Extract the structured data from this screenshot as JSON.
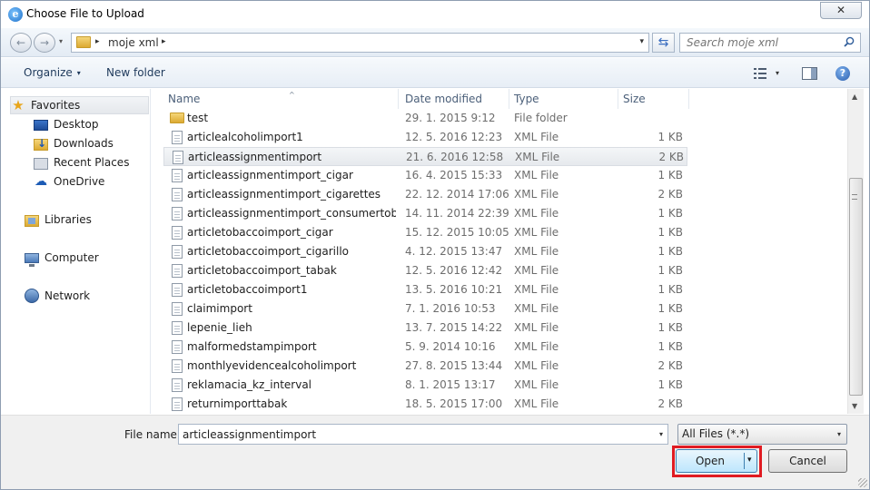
{
  "window": {
    "title": "Choose File to Upload",
    "close_glyph": "✕",
    "title_icon_glyph": "e"
  },
  "nav": {
    "back_glyph": "←",
    "forward_glyph": "→",
    "dropdown_glyph": "▾",
    "path_separator": "▸",
    "path": "moje xml",
    "address_dropdown_glyph": "▾",
    "refresh_glyph": "⇆",
    "search_placeholder": "Search moje xml"
  },
  "toolbar": {
    "organize_label": "Organize",
    "organize_caret": "▾",
    "new_folder_label": "New folder",
    "view_caret": "▾",
    "help_glyph": "?"
  },
  "sidebar": {
    "favorites": "Favorites",
    "items": [
      {
        "label": "Desktop",
        "icon": "desktop-icon"
      },
      {
        "label": "Downloads",
        "icon": "downloads-icon"
      },
      {
        "label": "Recent Places",
        "icon": "recent-places-icon"
      },
      {
        "label": "OneDrive",
        "icon": "onedrive-icon"
      }
    ],
    "libraries": "Libraries",
    "computer": "Computer",
    "network": "Network",
    "star_glyph": "★",
    "cloud_glyph": "☁"
  },
  "columns": {
    "name": "Name",
    "date": "Date modified",
    "type": "Type",
    "size": "Size",
    "sort_glyph": "^"
  },
  "files": [
    {
      "name": "test",
      "date": "29. 1. 2015 9:12",
      "type": "File folder",
      "size": "",
      "folder": true
    },
    {
      "name": "articlealcoholimport1",
      "date": "12. 5. 2016 12:23",
      "type": "XML File",
      "size": "1 KB"
    },
    {
      "name": "articleassignmentimport",
      "date": "21. 6. 2016 12:58",
      "type": "XML File",
      "size": "2 KB",
      "selected": true
    },
    {
      "name": "articleassignmentimport_cigar",
      "date": "16. 4. 2015 15:33",
      "type": "XML File",
      "size": "1 KB"
    },
    {
      "name": "articleassignmentimport_cigarettes",
      "date": "22. 12. 2014 17:06",
      "type": "XML File",
      "size": "2 KB"
    },
    {
      "name": "articleassignmentimport_consumertobac...",
      "date": "14. 11. 2014 22:39",
      "type": "XML File",
      "size": "1 KB"
    },
    {
      "name": "articletobaccoimport_cigar",
      "date": "15. 12. 2015 10:05",
      "type": "XML File",
      "size": "1 KB"
    },
    {
      "name": "articletobaccoimport_cigarillo",
      "date": "4. 12. 2015 13:47",
      "type": "XML File",
      "size": "1 KB"
    },
    {
      "name": "articletobaccoimport_tabak",
      "date": "12. 5. 2016 12:42",
      "type": "XML File",
      "size": "1 KB"
    },
    {
      "name": "articletobaccoimport1",
      "date": "13. 5. 2016 10:21",
      "type": "XML File",
      "size": "1 KB"
    },
    {
      "name": "claimimport",
      "date": "7. 1. 2016 10:53",
      "type": "XML File",
      "size": "1 KB"
    },
    {
      "name": "lepenie_lieh",
      "date": "13. 7. 2015 14:22",
      "type": "XML File",
      "size": "1 KB"
    },
    {
      "name": "malformedstampimport",
      "date": "5. 9. 2014 10:16",
      "type": "XML File",
      "size": "1 KB"
    },
    {
      "name": "monthlyevidencealcoholimport",
      "date": "27. 8. 2015 13:44",
      "type": "XML File",
      "size": "2 KB"
    },
    {
      "name": "reklamacia_kz_interval",
      "date": "8. 1. 2015 13:17",
      "type": "XML File",
      "size": "1 KB"
    },
    {
      "name": "returnimporttabak",
      "date": "18. 5. 2015 17:00",
      "type": "XML File",
      "size": "2 KB"
    }
  ],
  "scrollbar": {
    "up_glyph": "▲",
    "down_glyph": "▼",
    "position": 0.42
  },
  "footer": {
    "file_name_label": "File name:",
    "file_name_value": "articleassignmentimport",
    "file_name_dropdown_glyph": "▾",
    "file_type_value": "All Files (*.*)",
    "file_type_dropdown_glyph": "▾",
    "open_label": "Open",
    "open_dropdown_glyph": "▾",
    "cancel_label": "Cancel"
  },
  "colors": {
    "highlight": "#e01b22",
    "accent": "#3c7fb1"
  }
}
